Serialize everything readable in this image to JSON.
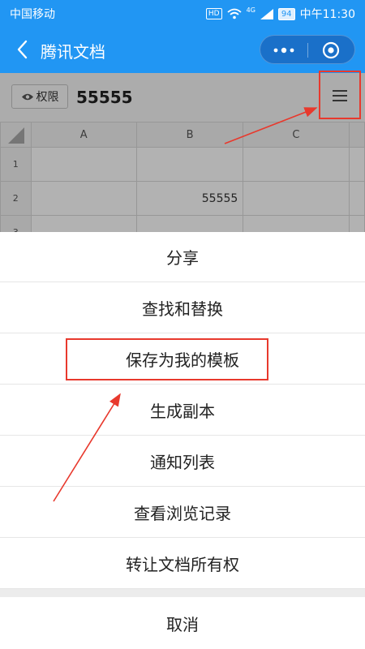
{
  "status_bar": {
    "carrier": "中国移动",
    "hd": "HD",
    "network": "4G",
    "battery": "94",
    "time": "中午11:30"
  },
  "titlebar": {
    "title": "腾讯文档"
  },
  "toolbar": {
    "permission_label": "权限",
    "doc_title": "55555"
  },
  "sheet": {
    "columns": [
      "A",
      "B",
      "C"
    ],
    "rows": [
      "1",
      "2",
      "3"
    ],
    "cell_b2": "55555"
  },
  "action_menu": {
    "items": [
      "分享",
      "查找和替换",
      "保存为我的模板",
      "生成副本",
      "通知列表",
      "查看浏览记录",
      "转让文档所有权"
    ],
    "cancel": "取消"
  },
  "colors": {
    "brand_blue": "#2196f3",
    "annotation_red": "#e8392d"
  }
}
